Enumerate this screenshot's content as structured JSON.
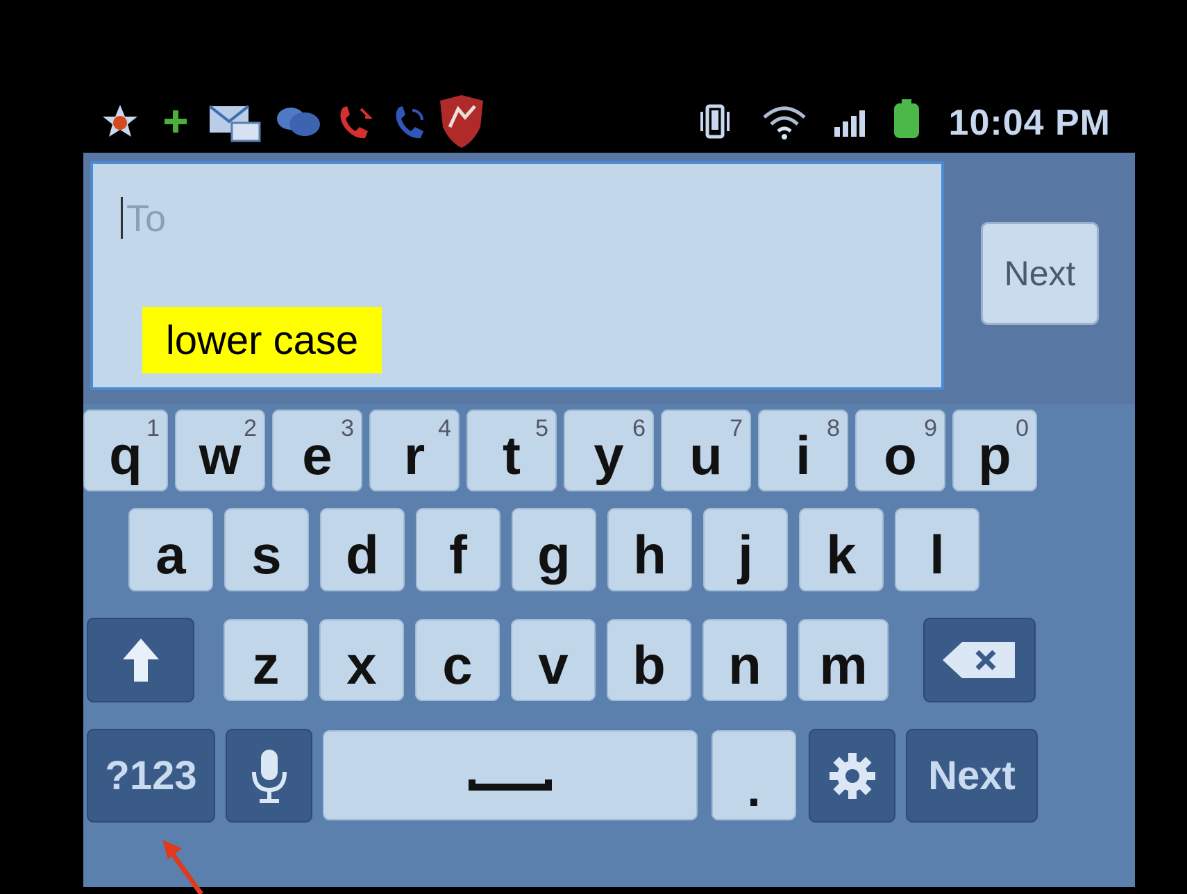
{
  "status_bar": {
    "time": "10:04 PM",
    "left_icons": [
      "star-badge-icon",
      "plus-icon",
      "messages-icon",
      "chat-bubbles-icon",
      "missed-call-icon",
      "call-forward-icon",
      "shield-app-icon"
    ],
    "right_icons": [
      "vibrate-icon",
      "wifi-icon",
      "signal-icon",
      "battery-icon"
    ]
  },
  "compose": {
    "to_placeholder": "To",
    "next_label": "Next"
  },
  "annotation": {
    "label": "lower case",
    "highlight_color": "#ffff00",
    "arrow_color": "#e03a1e"
  },
  "keyboard": {
    "row1": [
      {
        "key": "q",
        "sub": "1"
      },
      {
        "key": "w",
        "sub": "2"
      },
      {
        "key": "e",
        "sub": "3"
      },
      {
        "key": "r",
        "sub": "4"
      },
      {
        "key": "t",
        "sub": "5"
      },
      {
        "key": "y",
        "sub": "6"
      },
      {
        "key": "u",
        "sub": "7"
      },
      {
        "key": "i",
        "sub": "8"
      },
      {
        "key": "o",
        "sub": "9"
      },
      {
        "key": "p",
        "sub": "0"
      }
    ],
    "row2": [
      {
        "key": "a"
      },
      {
        "key": "s"
      },
      {
        "key": "d"
      },
      {
        "key": "f"
      },
      {
        "key": "g"
      },
      {
        "key": "h"
      },
      {
        "key": "j"
      },
      {
        "key": "k"
      },
      {
        "key": "l"
      }
    ],
    "row3": [
      {
        "key": "z"
      },
      {
        "key": "x"
      },
      {
        "key": "c"
      },
      {
        "key": "v"
      },
      {
        "key": "b"
      },
      {
        "key": "n"
      },
      {
        "key": "m"
      }
    ],
    "symbols_label": "?123",
    "period_label": ".",
    "next_label": "Next"
  }
}
